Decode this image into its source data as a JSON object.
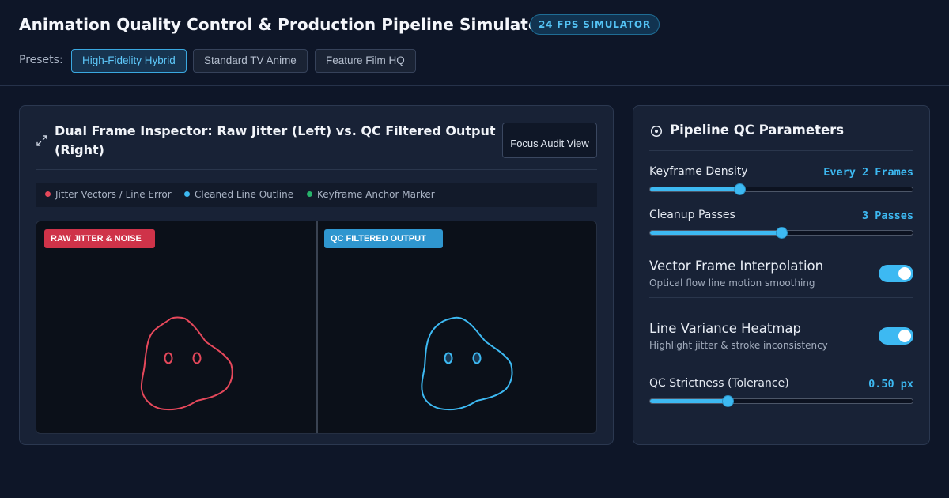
{
  "header": {
    "title": "Animation Quality Control & Production Pipeline Simulator",
    "badge": "24 FPS SIMULATOR",
    "presets_label": "Presets:",
    "presets": [
      "High-Fidelity Hybrid",
      "Standard TV Anime",
      "Feature Film HQ"
    ],
    "active_preset": "High-Fidelity Hybrid"
  },
  "inspector": {
    "title": "Dual Frame Inspector: Raw Jitter (Left) vs. QC Filtered Output (Right)",
    "focus_button": "Focus Audit View",
    "legend": [
      {
        "label": "Jitter Vectors / Line Error",
        "color": "#e5485b"
      },
      {
        "label": "Cleaned Line Outline",
        "color": "#3db9f2"
      },
      {
        "label": "Keyframe Anchor Marker",
        "color": "#27b36b"
      }
    ],
    "raw_label": "RAW JITTER & NOISE",
    "qc_label": "QC FILTERED OUTPUT",
    "raw_stroke_color": "#e5485b",
    "qc_stroke_color": "#3db9f2"
  },
  "params": {
    "title": "Pipeline QC Parameters",
    "keyframe_density": {
      "label": "Keyframe Density",
      "value": "Every 2 Frames",
      "level": 0.34
    },
    "cleanup_passes": {
      "label": "Cleanup Passes",
      "value": "3 Passes",
      "level": 0.5
    },
    "vector_interpolation": {
      "label": "Vector Frame Interpolation",
      "description": "Optical flow line motion smoothing",
      "on": true
    },
    "line_variance": {
      "label": "Line Variance Heatmap",
      "description": "Highlight jitter & stroke inconsistency",
      "on": true
    },
    "qc_strictness": {
      "label": "QC Strictness (Tolerance)",
      "value": "0.50 px",
      "level": 0.295
    }
  }
}
